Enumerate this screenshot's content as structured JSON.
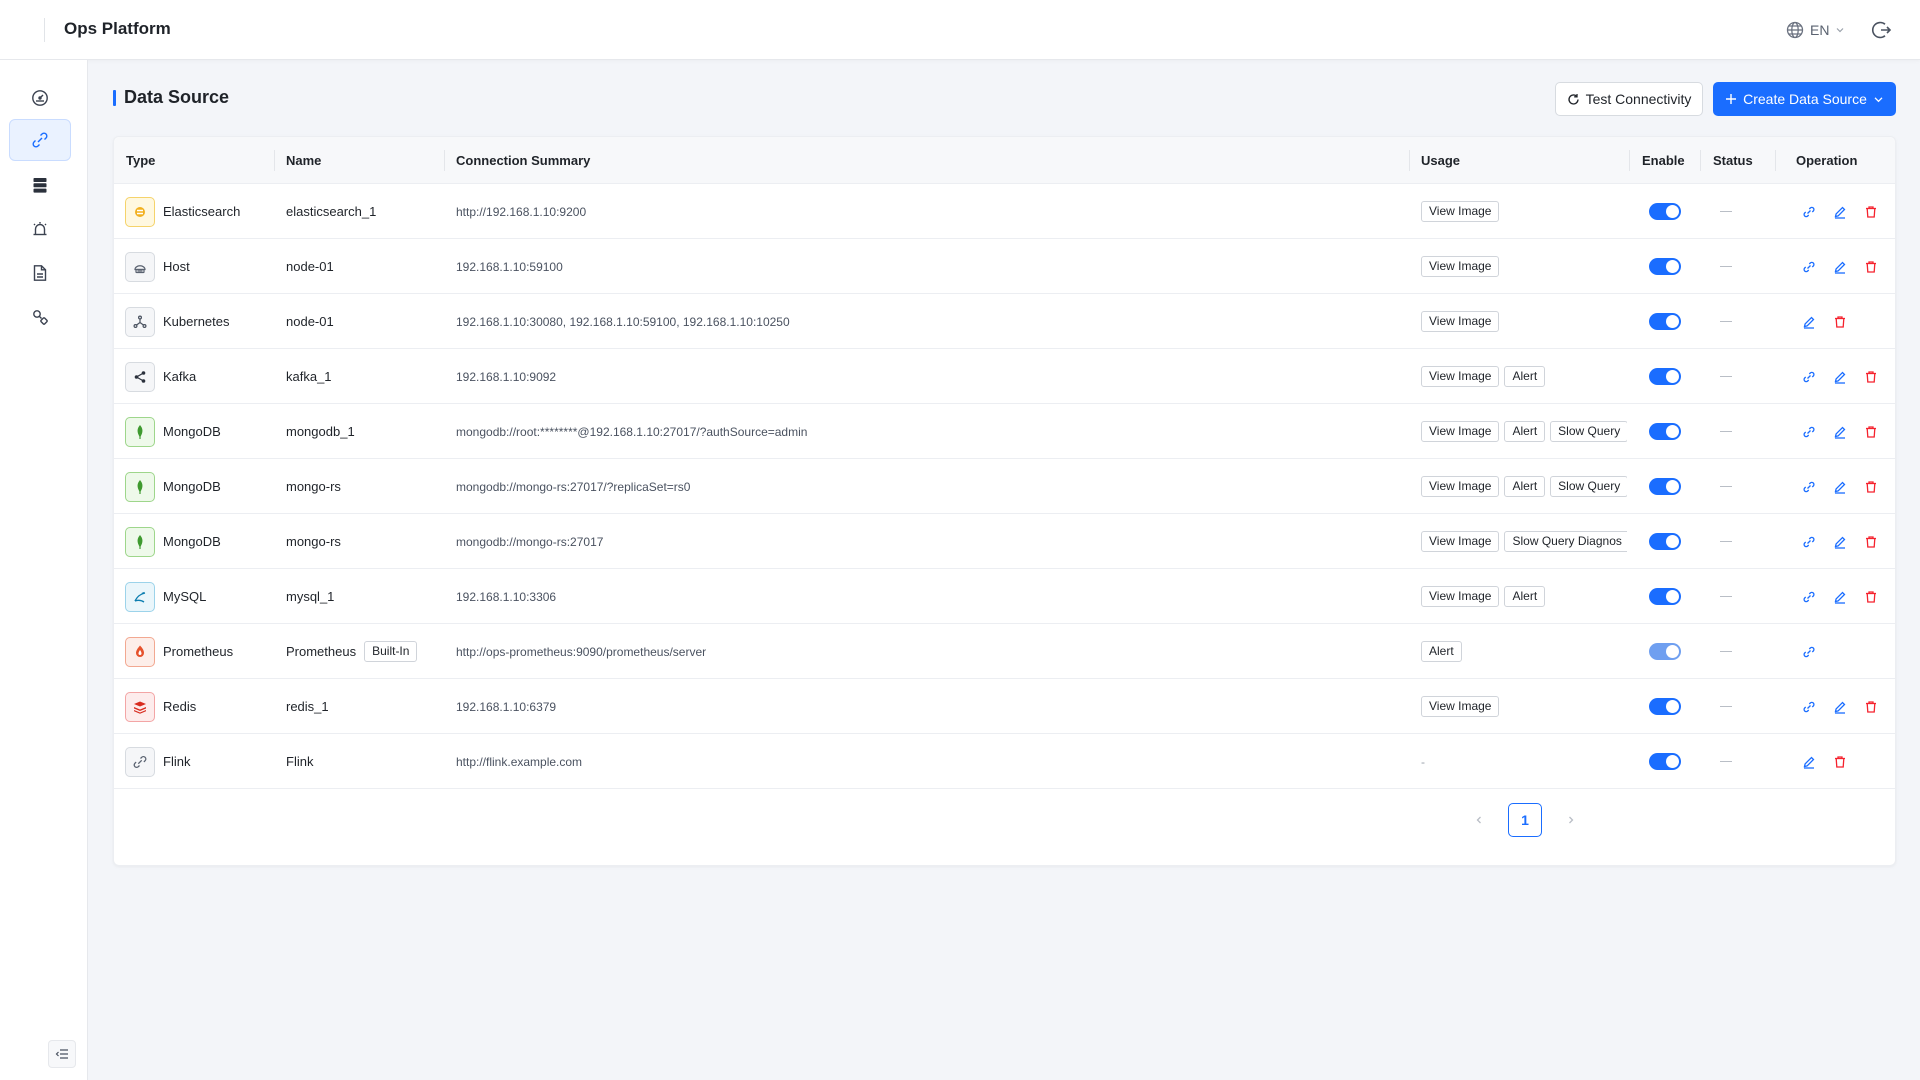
{
  "app": {
    "title": "Ops Platform"
  },
  "header": {
    "language": "EN",
    "language_icon": "globe-icon",
    "logout_icon": "logout-icon"
  },
  "sidebar": {
    "items": [
      {
        "id": "dashboard",
        "icon": "dashboard-gauge-icon",
        "active": false
      },
      {
        "id": "data-source",
        "icon": "link-plug-icon",
        "active": true
      },
      {
        "id": "database",
        "icon": "database-stack-icon",
        "active": false
      },
      {
        "id": "alert",
        "icon": "alarm-siren-icon",
        "active": false
      },
      {
        "id": "report",
        "icon": "document-icon",
        "active": false
      },
      {
        "id": "diagnosis",
        "icon": "search-chain-icon",
        "active": false
      }
    ],
    "collapse_icon": "collapse-menu-icon"
  },
  "page": {
    "title": "Data Source",
    "test_button": "Test Connectivity",
    "create_button": "Create Data Source"
  },
  "table": {
    "columns": {
      "type": "Type",
      "name": "Name",
      "summary": "Connection Summary",
      "usage": "Usage",
      "enable": "Enable",
      "status": "Status",
      "operation": "Operation"
    },
    "rows": [
      {
        "type": "Elasticsearch",
        "icon": "elasticsearch-icon",
        "name": "elasticsearch_1",
        "summary": "http://192.168.1.10:9200",
        "usage": [
          "View Image"
        ],
        "enabled": true,
        "status": "—",
        "operations": [
          "link",
          "edit",
          "delete"
        ]
      },
      {
        "type": "Host",
        "icon": "host-icon",
        "name": "node-01",
        "summary": "192.168.1.10:59100",
        "usage": [
          "View Image"
        ],
        "enabled": true,
        "status": "—",
        "operations": [
          "link",
          "edit",
          "delete"
        ]
      },
      {
        "type": "Kubernetes",
        "icon": "kubernetes-icon",
        "name": "node-01",
        "summary": "192.168.1.10:30080, 192.168.1.10:59100, 192.168.1.10:10250",
        "usage": [
          "View Image"
        ],
        "enabled": true,
        "status": "—",
        "operations": [
          "edit",
          "delete"
        ]
      },
      {
        "type": "Kafka",
        "icon": "kafka-icon",
        "name": "kafka_1",
        "summary": "192.168.1.10:9092",
        "usage": [
          "View Image",
          "Alert"
        ],
        "enabled": true,
        "status": "—",
        "operations": [
          "link",
          "edit",
          "delete"
        ]
      },
      {
        "type": "MongoDB",
        "icon": "mongodb-leaf-icon",
        "name": "mongodb_1",
        "summary": "mongodb://root:********@192.168.1.10:27017/?authSource=admin",
        "usage": [
          "View Image",
          "Alert",
          "Slow Query"
        ],
        "enabled": true,
        "status": "—",
        "operations": [
          "link",
          "edit",
          "delete"
        ]
      },
      {
        "type": "MongoDB",
        "icon": "mongodb-leaf-icon",
        "name": "mongo-rs",
        "summary": "mongodb://mongo-rs:27017/?replicaSet=rs0",
        "usage": [
          "View Image",
          "Alert",
          "Slow Query"
        ],
        "enabled": true,
        "status": "—",
        "operations": [
          "link",
          "edit",
          "delete"
        ]
      },
      {
        "type": "MongoDB",
        "icon": "mongodb-leaf-icon",
        "name": "mongo-rs",
        "summary": "mongodb://mongo-rs:27017",
        "usage": [
          "View Image",
          "Slow Query Diagnos"
        ],
        "enabled": true,
        "status": "—",
        "operations": [
          "link",
          "edit",
          "delete"
        ]
      },
      {
        "type": "MySQL",
        "icon": "mysql-dolphin-icon",
        "name": "mysql_1",
        "summary": "192.168.1.10:3306",
        "usage": [
          "View Image",
          "Alert"
        ],
        "enabled": true,
        "status": "—",
        "operations": [
          "link",
          "edit",
          "delete"
        ]
      },
      {
        "type": "Prometheus",
        "icon": "prometheus-flame-icon",
        "name": "Prometheus",
        "badge": "Built-In",
        "summary": "http://ops-prometheus:9090/prometheus/server",
        "usage": [
          "Alert"
        ],
        "enabled": true,
        "soft": true,
        "status": "—",
        "operations": [
          "link"
        ]
      },
      {
        "type": "Redis",
        "icon": "redis-stack-icon",
        "name": "redis_1",
        "summary": "192.168.1.10:6379",
        "usage": [
          "View Image"
        ],
        "enabled": true,
        "status": "—",
        "operations": [
          "link",
          "edit",
          "delete"
        ]
      },
      {
        "type": "Flink",
        "icon": "flink-link-icon",
        "name": "Flink",
        "summary": "http://flink.example.com",
        "usage": [],
        "usage_empty": "-",
        "enabled": true,
        "status": "—",
        "operations": [
          "edit",
          "delete"
        ]
      }
    ]
  },
  "pagination": {
    "current": "1"
  },
  "colors": {
    "primary": "#1a6dff",
    "danger": "#f5222d",
    "background": "#f3f5f9"
  }
}
